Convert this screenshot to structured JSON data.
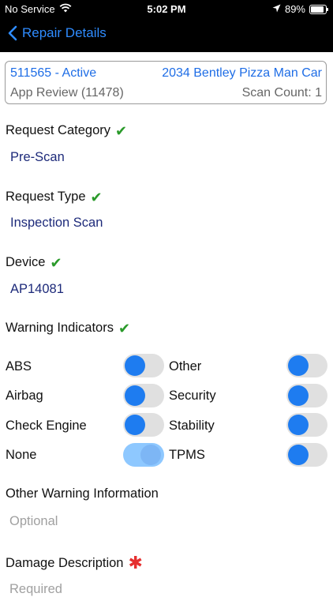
{
  "status_bar": {
    "carrier": "No Service",
    "time": "5:02 PM",
    "battery": "89%"
  },
  "nav": {
    "back_label": "Repair Details"
  },
  "info_box": {
    "id_status": "511565 - Active",
    "vehicle": "2034 Bentley Pizza Man Car",
    "app_review": "App Review (11478)",
    "scan_count": "Scan Count: 1"
  },
  "sections": {
    "request_category": {
      "label": "Request Category",
      "value": "Pre-Scan"
    },
    "request_type": {
      "label": "Request Type",
      "value": "Inspection Scan"
    },
    "device": {
      "label": "Device",
      "value": "AP14081"
    },
    "warning_indicators": {
      "label": "Warning Indicators"
    }
  },
  "toggles": [
    {
      "label": "ABS",
      "on": false
    },
    {
      "label": "Other",
      "on": false
    },
    {
      "label": "Airbag",
      "on": false
    },
    {
      "label": "Security",
      "on": false
    },
    {
      "label": "Check Engine",
      "on": false
    },
    {
      "label": "Stability",
      "on": false
    },
    {
      "label": "None",
      "on": true
    },
    {
      "label": "TPMS",
      "on": false
    }
  ],
  "other_warning": {
    "label": "Other Warning Information",
    "placeholder": "Optional"
  },
  "damage": {
    "label": "Damage Description",
    "placeholder": "Required"
  },
  "colors": {
    "accent": "#2f8cff",
    "value_text": "#1d2a7a",
    "check": "#2a9a2a",
    "required": "#e53030"
  }
}
